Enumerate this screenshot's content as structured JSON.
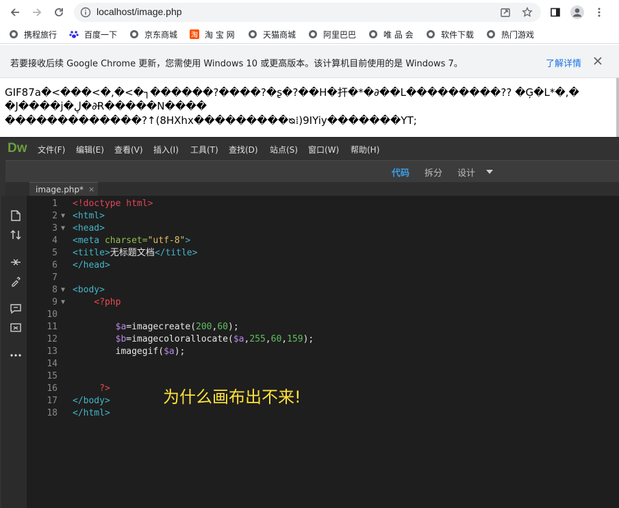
{
  "browser": {
    "url": "localhost/image.php",
    "bookmarks": [
      "携程旅行",
      "百度一下",
      "京东商城",
      "淘 宝 网",
      "天猫商城",
      "阿里巴巴",
      "唯 品 会",
      "软件下载",
      "热门游戏"
    ],
    "infobar": {
      "message": "若要接收后续 Google Chrome 更新，您需使用 Windows 10 或更高版本。该计算机目前使用的是 Windows 7。",
      "learn_more": "了解详情"
    }
  },
  "page": {
    "garbled_lines": [
      "GIF87a�<���<�,�<�┐������?����?�ʂ�?��H�扞�*�∂��L���������?? �Ģ�L*�,�",
      "�J����j�ڸ�∂Ɍ�����N����",
      "�������������?↑(8HXhx���������ᴓ⁞)9IYiy�������YT;"
    ]
  },
  "dreamweaver": {
    "logo": "Dw",
    "menus": [
      "文件(F)",
      "编辑(E)",
      "查看(V)",
      "插入(I)",
      "工具(T)",
      "查找(D)",
      "站点(S)",
      "窗口(W)",
      "帮助(H)"
    ],
    "views": {
      "code": "代码",
      "split": "拆分",
      "design": "设计"
    },
    "tab": {
      "name": "image.php*",
      "close": "×"
    },
    "line_numbers": [
      "1",
      "2",
      "3",
      "4",
      "5",
      "6",
      "7",
      "8",
      "9",
      "10",
      "11",
      "12",
      "13",
      "14",
      "15",
      "16",
      "17",
      "18"
    ],
    "code": {
      "l1": "<!doctype html>",
      "l2": "<html>",
      "l3": "<head>",
      "l4_tag": "<meta",
      "l4_attr": " charset=",
      "l4_val": "\"utf-8\"",
      "l4_end": ">",
      "l5_open": "<title>",
      "l5_text": "无标题文档",
      "l5_close": "</title>",
      "l6": "</head>",
      "l8": "<body>",
      "l9": "<?php",
      "l11_var": "$a",
      "l11_fn": "=imagecreate(",
      "l11_n1": "200",
      "l11_c": ",",
      "l11_n2": "60",
      "l11_end": ");",
      "l12_var": "$b",
      "l12_fn": "=imagecolorallocate(",
      "l12_arg": "$a",
      "l12_c1": ",",
      "l12_n1": "255",
      "l12_c2": ",",
      "l12_n2": "60",
      "l12_c3": ",",
      "l12_n3": "159",
      "l12_end": ");",
      "l13_fn": "imagegif(",
      "l13_arg": "$a",
      "l13_end": ");",
      "l16": "?>",
      "l17": "</body>",
      "l18": "</html>"
    },
    "annotation": "为什么画布出不来!"
  }
}
